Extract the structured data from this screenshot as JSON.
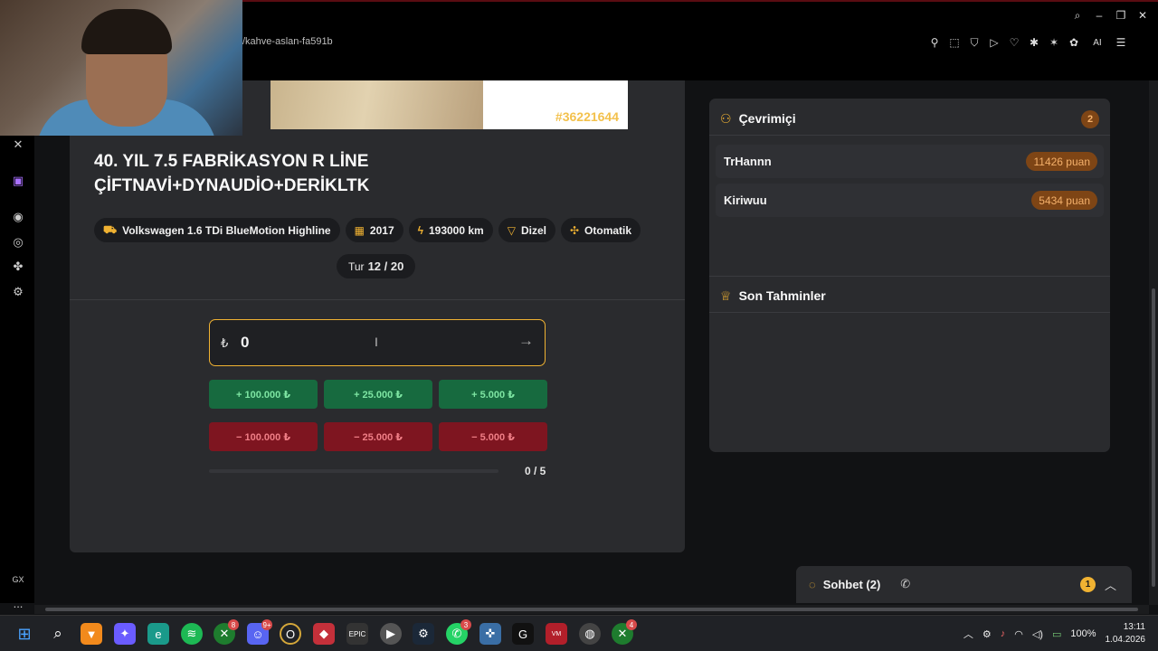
{
  "browser": {
    "url": "/kahve-aslan-fa591b",
    "window_controls": [
      "search-icon",
      "minimize-icon",
      "restore-icon",
      "close-icon"
    ],
    "extensions": [
      "pin-icon",
      "screenshot-icon",
      "shield-icon",
      "play-icon",
      "heart-icon",
      "extension-icon",
      "palm-icon",
      "crumb-icon",
      "ai-icon",
      "sidebar-icon"
    ],
    "ai_label": "AI"
  },
  "sidebar": {
    "icons": [
      "gx-logo-icon",
      "twitch-icon",
      "spotify-icon",
      "timer-icon",
      "tree-icon",
      "settings-icon"
    ],
    "gx_label": "GX",
    "more": "..."
  },
  "listing": {
    "image_id": "#36221644",
    "title": "40. YIL 7.5 FABRİKASYON R LİNE ÇİFTNAVİ+DYNAUDİO+DERİKLTK",
    "chips": [
      {
        "icon": "car-icon",
        "label": "Volkswagen 1.6 TDi BlueMotion Highline"
      },
      {
        "icon": "calendar-icon",
        "label": "2017"
      },
      {
        "icon": "bolt-icon",
        "label": "193000 km"
      },
      {
        "icon": "fuel-icon",
        "label": "Dizel"
      },
      {
        "icon": "gear-icon",
        "label": "Otomatik"
      }
    ],
    "tour_label": "Tur",
    "tour_value": "12 / 20"
  },
  "guess": {
    "currency": "₺",
    "value": "0",
    "plus_buttons": [
      "+ 100.000 ₺",
      "+ 25.000 ₺",
      "+ 5.000 ₺"
    ],
    "minus_buttons": [
      "− 100.000 ₺",
      "− 25.000 ₺",
      "− 5.000 ₺"
    ],
    "attempts": "0 / 5",
    "attempts_progress": 0
  },
  "online": {
    "title": "Çevrimiçi",
    "count": "2",
    "players": [
      {
        "name": "TrHannn",
        "points": "11426 puan"
      },
      {
        "name": "Kiriwuu",
        "points": "5434 puan"
      }
    ]
  },
  "recent": {
    "title": "Son Tahminler"
  },
  "chat": {
    "label": "Sohbet (2)",
    "unread": "1"
  },
  "taskbar": {
    "apps": [
      {
        "icon": "windows-start-icon",
        "badge": ""
      },
      {
        "icon": "search-icon",
        "badge": ""
      },
      {
        "icon": "brave-icon",
        "badge": ""
      },
      {
        "icon": "copilot-icon",
        "badge": ""
      },
      {
        "icon": "edge-icon",
        "badge": ""
      },
      {
        "icon": "spotify-icon",
        "badge": ""
      },
      {
        "icon": "xbox-icon",
        "badge": "8"
      },
      {
        "icon": "discord-icon",
        "badge": "9+"
      },
      {
        "icon": "opera-gx-icon",
        "badge": ""
      },
      {
        "icon": "league-icon",
        "badge": ""
      },
      {
        "icon": "epic-games-icon",
        "badge": ""
      },
      {
        "icon": "media-player-icon",
        "badge": ""
      },
      {
        "icon": "steam-icon",
        "badge": ""
      },
      {
        "icon": "whatsapp-icon",
        "badge": "3"
      },
      {
        "icon": "app-icon",
        "badge": ""
      },
      {
        "icon": "logitech-icon",
        "badge": ""
      },
      {
        "icon": "voicemeeter-icon",
        "badge": ""
      },
      {
        "icon": "obs-icon",
        "badge": ""
      },
      {
        "icon": "xbox-icon",
        "badge": "4"
      }
    ],
    "battery": "100%",
    "time": "13:11",
    "date": "1.04.2026"
  }
}
